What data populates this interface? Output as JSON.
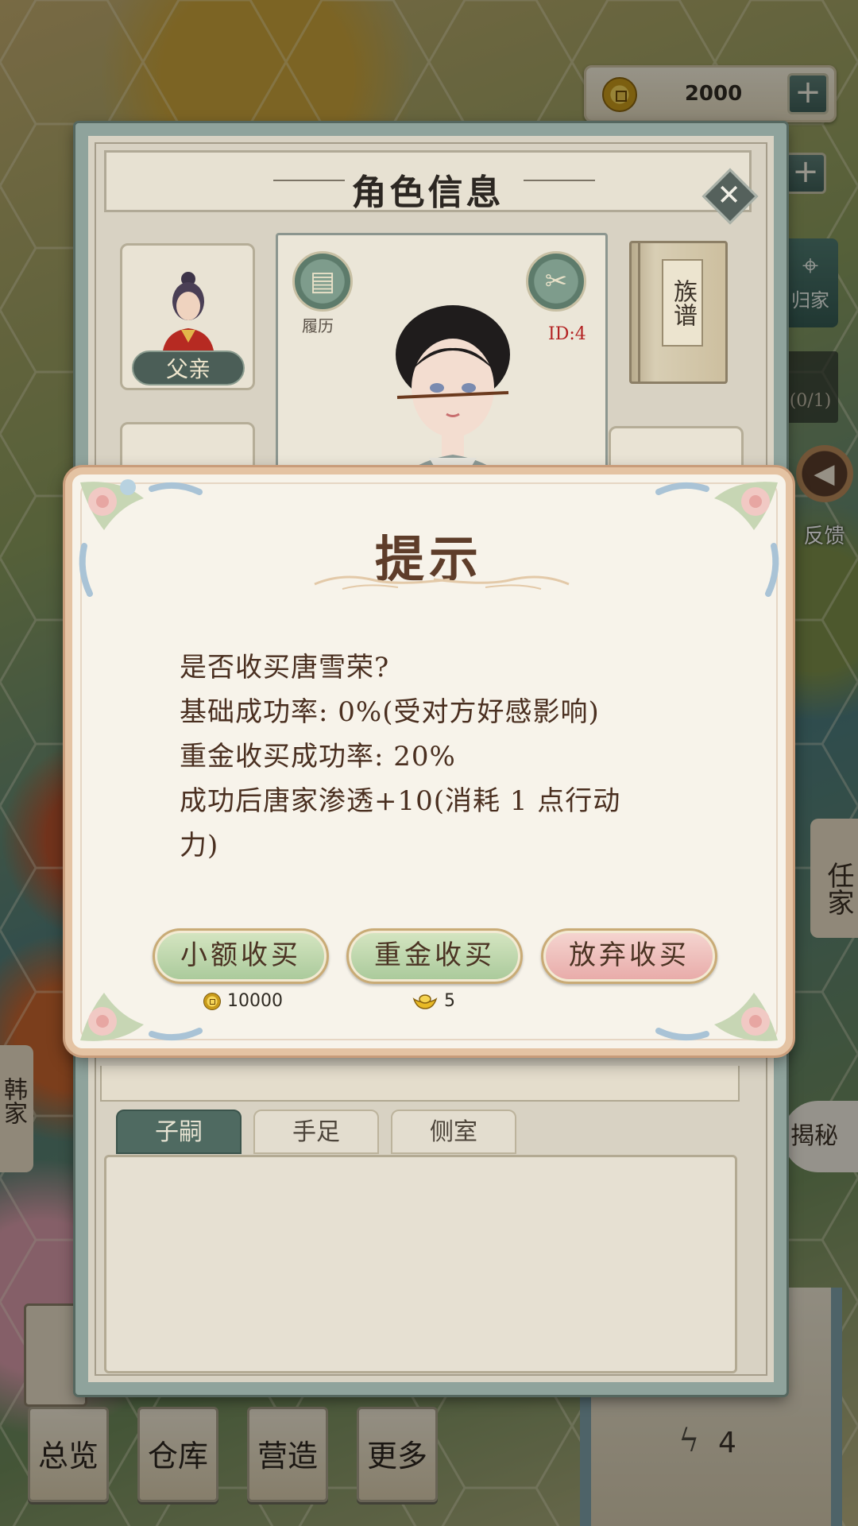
{
  "resources": {
    "coins": "2000"
  },
  "side": {
    "home_label": "归家",
    "quest_progress": "(0/1)",
    "feedback_label": "反馈",
    "right_tag": "任家",
    "left_tag": "韩家",
    "secret_label": "揭秘"
  },
  "bottom_menu": {
    "items": [
      "总览",
      "仓库",
      "营造",
      "更多"
    ],
    "energy": "4"
  },
  "character_panel": {
    "title": "角色信息",
    "father_label": "父亲",
    "resume_label": "履历",
    "id_label": "ID:4",
    "genealogy_label": "族谱",
    "tabs": [
      "子嗣",
      "手足",
      "侧室"
    ],
    "active_tab": "子嗣"
  },
  "dialog": {
    "title": "提示",
    "lines": [
      "是否收买唐雪荣?",
      "基础成功率: 0%(受对方好感影响)",
      "重金收买成功率: 20%",
      "成功后唐家渗透+10(消耗 1 点行动",
      "力)"
    ],
    "buttons": {
      "small": "小额收买",
      "heavy": "重金收买",
      "quit": "放弃收买"
    },
    "costs": {
      "small": "10000",
      "heavy": "5"
    }
  },
  "colors": {
    "dialog_title": "#5e3d2a",
    "dialog_text": "#4a2f20",
    "green_button": "#a9c99a",
    "pink_button": "#e8aaa8",
    "id_red": "#b32222",
    "panel_frame": "#8fa39c"
  },
  "icons": {
    "coin": "coin-icon",
    "ingot": "gold-ingot-icon",
    "close": "close-icon",
    "scissors": "scissors-icon",
    "resume": "scroll-icon",
    "location": "location-pin-icon",
    "energy": "lightning-icon",
    "megaphone": "megaphone-icon"
  }
}
